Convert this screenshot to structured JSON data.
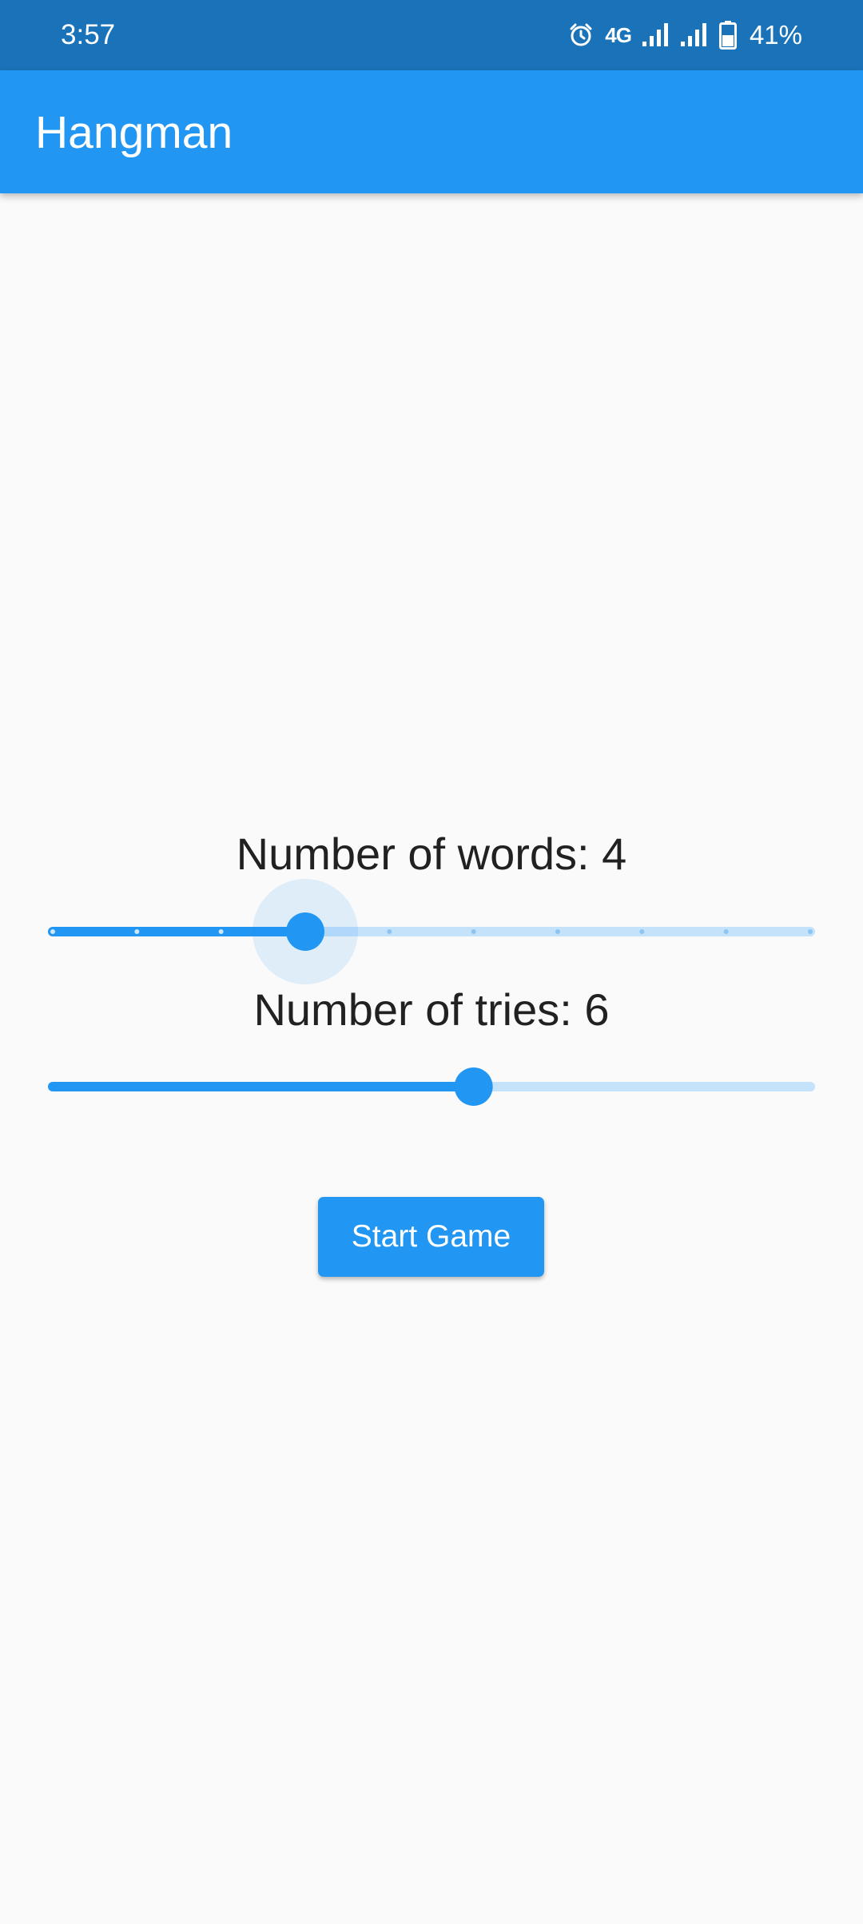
{
  "status_bar": {
    "time": "3:57",
    "network_type": "4G",
    "battery_percent": "41%",
    "icons": [
      "alarm-icon",
      "signal-icon",
      "signal-icon",
      "battery-icon"
    ]
  },
  "app_bar": {
    "title": "Hangman"
  },
  "words": {
    "label": "Number of words: 4",
    "value": 4,
    "min": 1,
    "max": 10,
    "divisions": 9
  },
  "tries": {
    "label": "Number of tries: 6",
    "value": 6,
    "min": 1,
    "max": 10
  },
  "start_button": {
    "label": "Start Game"
  },
  "colors": {
    "status_bar": "#1a73b8",
    "primary": "#2196f3",
    "track_inactive": "#c5e2fb",
    "background": "#fafafa",
    "text": "#212121"
  }
}
